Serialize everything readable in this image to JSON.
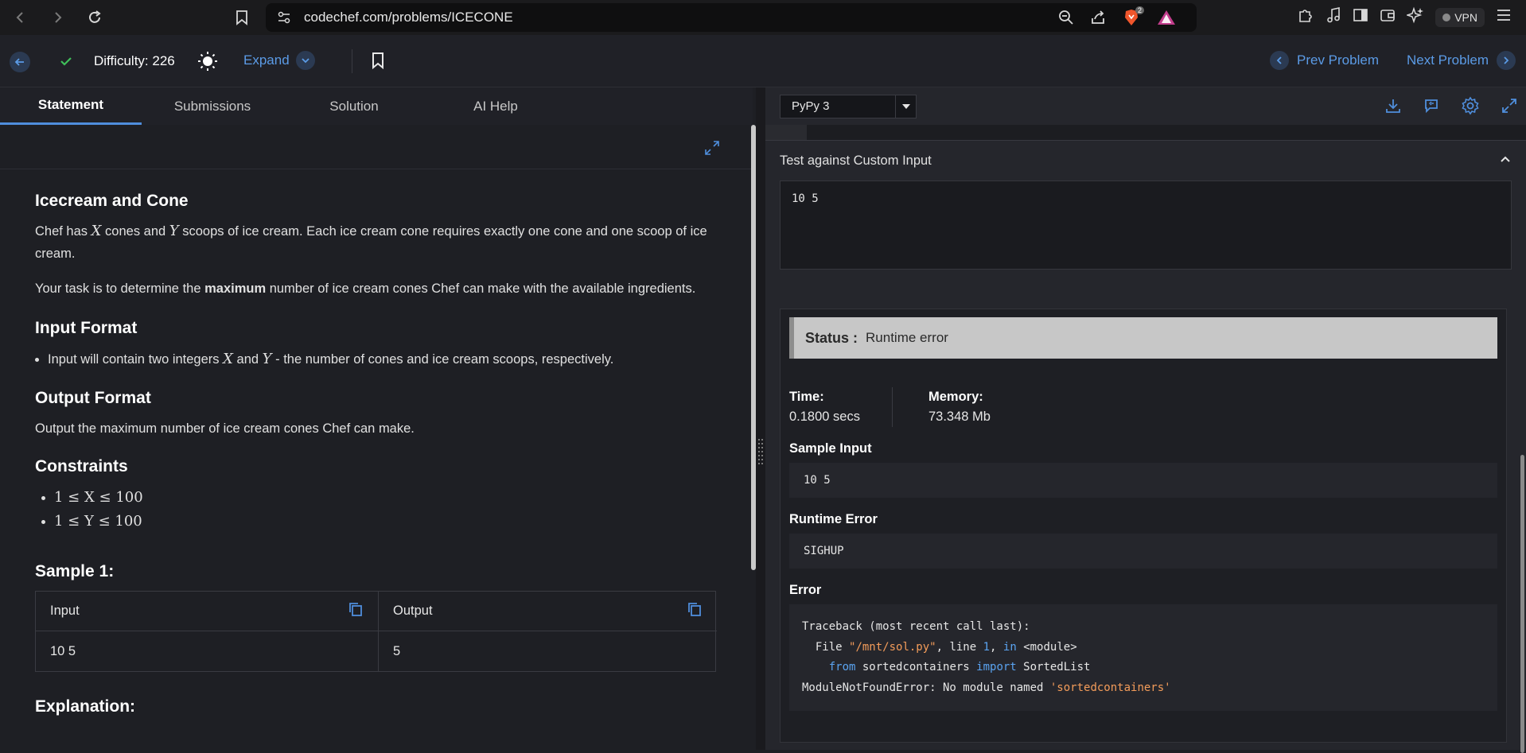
{
  "browser": {
    "url": "codechef.com/problems/ICECONE",
    "shield_badge": "2",
    "vpn_label": "VPN"
  },
  "topbar": {
    "difficulty": "Difficulty: 226",
    "expand_label": "Expand",
    "prev_label": "Prev Problem",
    "next_label": "Next Problem"
  },
  "tabs": [
    {
      "label": "Statement"
    },
    {
      "label": "Submissions"
    },
    {
      "label": "Solution"
    },
    {
      "label": "AI Help"
    }
  ],
  "problem": {
    "title": "Icecream and Cone",
    "p1_a": "Chef has ",
    "var_x": "X",
    "p1_b": " cones and ",
    "var_y": "Y",
    "p1_c": " scoops of ice cream. Each ice cream cone requires exactly one cone and one scoop of ice cream.",
    "p2_a": "Your task is to determine the ",
    "p2_bold": "maximum",
    "p2_b": " number of ice cream cones Chef can make with the available ingredients.",
    "input_heading": "Input Format",
    "input_a": "Input will contain two integers ",
    "input_and": " and ",
    "input_b": " - the number of cones and ice cream scoops, respectively.",
    "output_heading": "Output Format",
    "output_text": "Output the maximum number of ice cream cones Chef can make.",
    "constraints_heading": "Constraints",
    "constraint_1": "1 ≤ X ≤ 100",
    "constraint_2": "1 ≤ Y ≤ 100",
    "sample_heading": "Sample 1:",
    "sample_input_label": "Input",
    "sample_output_label": "Output",
    "sample_input": "10 5",
    "sample_output": "5",
    "explanation_heading": "Explanation:"
  },
  "editor": {
    "language": "PyPy 3",
    "custom_input_label": "Test against Custom Input",
    "custom_input_value": "10 5"
  },
  "result": {
    "status_label": "Status :",
    "status_value": "Runtime error",
    "time_label": "Time:",
    "time_value": "0.1800 secs",
    "memory_label": "Memory:",
    "memory_value": "73.348 Mb",
    "sample_input_label": "Sample Input",
    "sample_input_value": "10 5",
    "runtime_error_label": "Runtime Error",
    "runtime_error_value": "SIGHUP",
    "error_label": "Error",
    "trace": {
      "line1": "Traceback (most recent call last):",
      "l2_a": "  File ",
      "l2_file": "\"/mnt/sol.py\"",
      "l2_b": ", line ",
      "l2_num": "1",
      "l2_c": ", ",
      "l2_in": "in",
      "l2_d": " <module>",
      "l3_pad": "    ",
      "l3_from": "from",
      "l3_mod": " sortedcontainers ",
      "l3_import": "import",
      "l3_name": " SortedList",
      "l4_a": "ModuleNotFoundError: No module named ",
      "l4_str": "'sortedcontainers'"
    }
  }
}
